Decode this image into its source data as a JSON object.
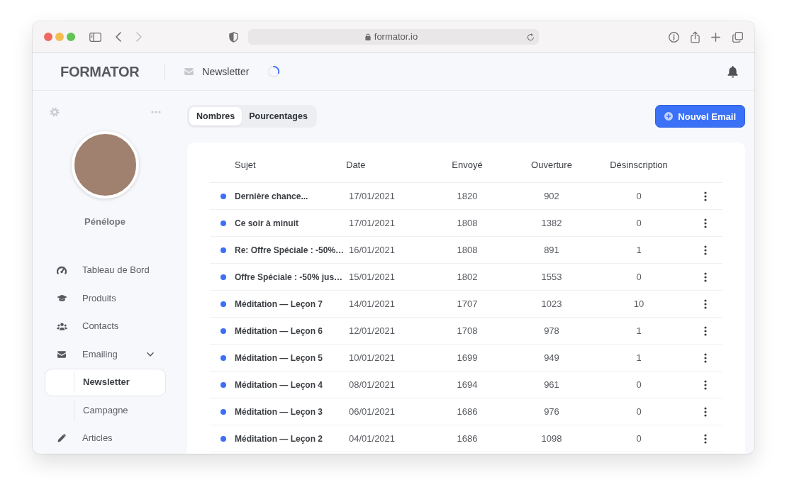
{
  "browser": {
    "url": "formator.io",
    "back": {
      "disabled": false
    },
    "forward": {
      "disabled": true
    }
  },
  "header": {
    "logo": "FORMATOR",
    "title": "Newsletter",
    "loading": true
  },
  "sidebar": {
    "user_name": "Pénélope",
    "items": [
      {
        "label": "Tableau de Bord",
        "selected": false
      },
      {
        "label": "Produits",
        "selected": false
      },
      {
        "label": "Contacts",
        "selected": false
      },
      {
        "label": "Emailing",
        "selected": false,
        "expanded": true,
        "children": [
          {
            "label": "Newsletter",
            "selected": true
          },
          {
            "label": "Campagne",
            "selected": false
          }
        ]
      },
      {
        "label": "Articles",
        "selected": false
      }
    ]
  },
  "tabs": [
    {
      "label": "Nombres",
      "selected": true
    },
    {
      "label": "Pourcentages",
      "selected": false
    }
  ],
  "new_email_button": {
    "label": "Nouvel Email"
  },
  "table": {
    "columns": [
      "Sujet",
      "Date",
      "Envoyé",
      "Ouverture",
      "Désinscription"
    ],
    "rows": [
      {
        "subject": "Dernière chance...",
        "date": "17/01/2021",
        "sent": "1820",
        "opens": "902",
        "unsubscribes": "0"
      },
      {
        "subject": "Ce soir à minuit",
        "date": "17/01/2021",
        "sent": "1808",
        "opens": "1382",
        "unsubscribes": "0"
      },
      {
        "subject": "Re: Offre Spéciale : -50%…",
        "date": "16/01/2021",
        "sent": "1808",
        "opens": "891",
        "unsubscribes": "1"
      },
      {
        "subject": "Offre Spéciale : -50% jus…",
        "date": "15/01/2021",
        "sent": "1802",
        "opens": "1553",
        "unsubscribes": "0"
      },
      {
        "subject": "Méditation — Leçon 7",
        "date": "14/01/2021",
        "sent": "1707",
        "opens": "1023",
        "unsubscribes": "10"
      },
      {
        "subject": "Méditation — Leçon 6",
        "date": "12/01/2021",
        "sent": "1708",
        "opens": "978",
        "unsubscribes": "1"
      },
      {
        "subject": "Méditation — Leçon 5",
        "date": "10/01/2021",
        "sent": "1699",
        "opens": "949",
        "unsubscribes": "1"
      },
      {
        "subject": "Méditation — Leçon 4",
        "date": "08/01/2021",
        "sent": "1694",
        "opens": "961",
        "unsubscribes": "0"
      },
      {
        "subject": "Méditation — Leçon 3",
        "date": "06/01/2021",
        "sent": "1686",
        "opens": "976",
        "unsubscribes": "0"
      },
      {
        "subject": "Méditation — Leçon 2",
        "date": "04/01/2021",
        "sent": "1686",
        "opens": "1098",
        "unsubscribes": "0"
      }
    ]
  }
}
